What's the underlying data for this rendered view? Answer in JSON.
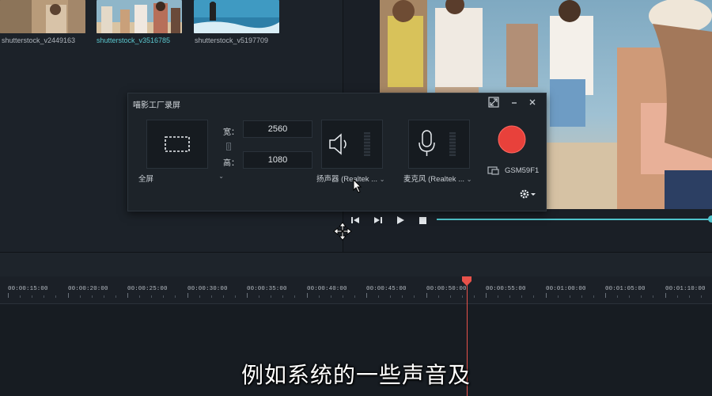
{
  "media_library": {
    "items": [
      {
        "label": "shutterstock_v2449163",
        "selected": false
      },
      {
        "label": "shutterstock_v3516785",
        "selected": true
      },
      {
        "label": "shutterstock_v5197709",
        "selected": false
      }
    ]
  },
  "recorder": {
    "title": "喵影工厂录屏",
    "area_mode": "全屏",
    "width_label": "宽：",
    "width_value": "2560",
    "height_label": "高：",
    "height_value": "1080",
    "speaker_label": "扬声器 (Realtek ...",
    "mic_label": "麦克风 (Realtek ...",
    "display_label": "GSM59F1"
  },
  "timeline": {
    "ticks": [
      "00:00:15:00",
      "00:00:20:00",
      "00:00:25:00",
      "00:00:30:00",
      "00:00:35:00",
      "00:00:40:00",
      "00:00:45:00",
      "00:00:50:00",
      "00:00:55:00",
      "00:01:00:00",
      "00:01:05:00",
      "00:01:10:00"
    ],
    "playhead_time": "00:00:50:00"
  },
  "subtitle": "例如系统的一些声音及",
  "colors": {
    "accent": "#4fc3cb",
    "record": "#e8413b",
    "playhead": "#e8524a"
  }
}
